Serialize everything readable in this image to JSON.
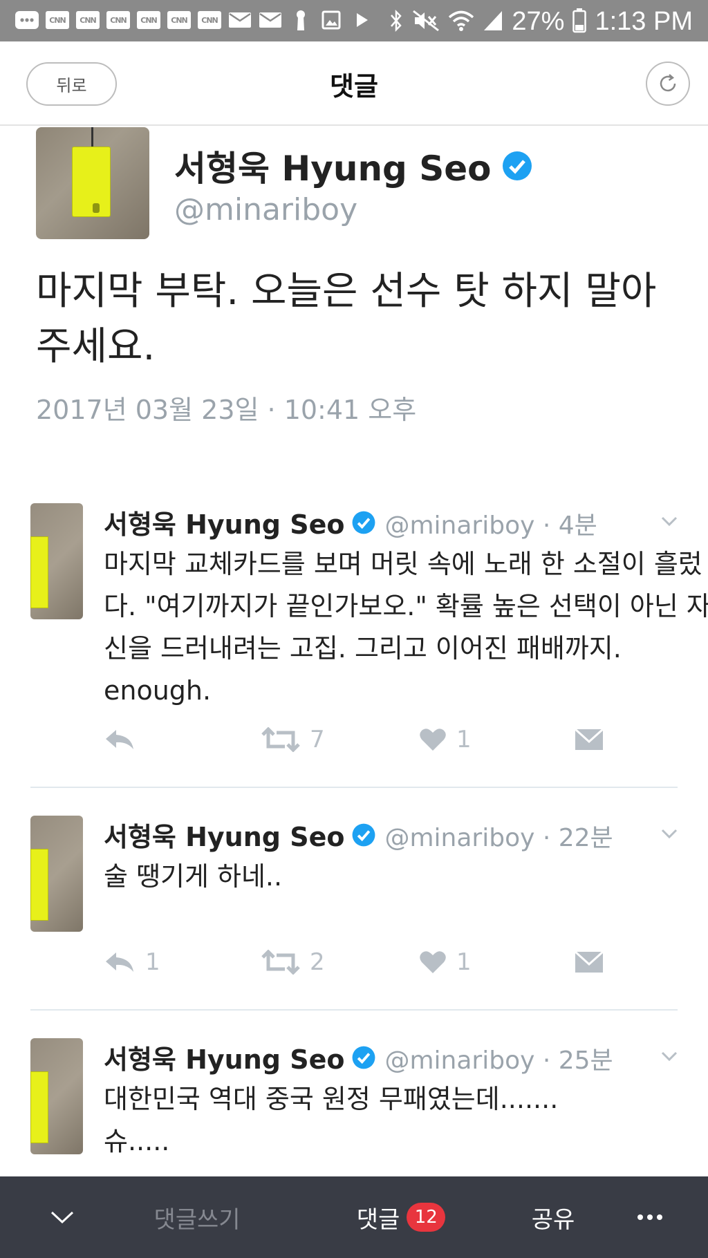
{
  "status_bar": {
    "battery": "27%",
    "time": "1:13 PM",
    "cnn_label": "CNN",
    "left_icons": [
      "more-icon",
      "cnn-icon",
      "cnn-icon",
      "cnn-icon",
      "cnn-icon",
      "cnn-icon",
      "cnn-icon",
      "mail-icon",
      "mail-icon",
      "keyhole-icon",
      "image-icon",
      "play-icon"
    ],
    "right_icons": [
      "bluetooth-icon",
      "mute-icon",
      "wifi-icon",
      "signal-icon",
      "battery-icon"
    ]
  },
  "header": {
    "back_label": "뒤로",
    "title": "댓글",
    "refresh_icon": "refresh-icon"
  },
  "main_tweet": {
    "name": "서형욱 Hyung Seo",
    "handle": "@minariboy",
    "text": "마지막 부탁. 오늘은 선수 탓 하지 말아주세요.",
    "date": "2017년 03월 23일 · 10:41 오후",
    "verified_icon": "verified-badge-icon"
  },
  "replies": [
    {
      "name": "서형욱 Hyung Seo",
      "meta": "@minariboy · 4분",
      "text": "마지막 교체카드를 보며 머릿 속에 노래 한 소절이 흘렀다. \"여기까지가 끝인가보오.\" 확률 높은 선택이 아닌 자신을 드러내려는 고집. 그리고 이어진 패배까지. enough.",
      "reply_count": "",
      "retweet_count": "7",
      "like_count": "1"
    },
    {
      "name": "서형욱 Hyung Seo",
      "meta": "@minariboy · 22분",
      "text": "술 땡기게 하네..",
      "reply_count": "1",
      "retweet_count": "2",
      "like_count": "1"
    },
    {
      "name": "서형욱 Hyung Seo",
      "meta": "@minariboy · 25분",
      "text": "대한민국 역대 중국 원정 무패였는데....... 슈.....",
      "reply_count": "",
      "retweet_count": "",
      "like_count": ""
    }
  ],
  "bottom_bar": {
    "collapse_icon": "chevron-down-icon",
    "write_label": "댓글쓰기",
    "comments_label": "댓글",
    "comments_count": "12",
    "share_label": "공유",
    "more_icon": "more-dots-icon"
  },
  "colors": {
    "accent_blue": "#1da1f2",
    "muted_gray": "#9aa3ab",
    "action_gray": "#b8bfc6",
    "bottom_bar_bg": "#393c45",
    "badge_red": "#e8353e",
    "tag_yellow": "#e7f01a"
  }
}
